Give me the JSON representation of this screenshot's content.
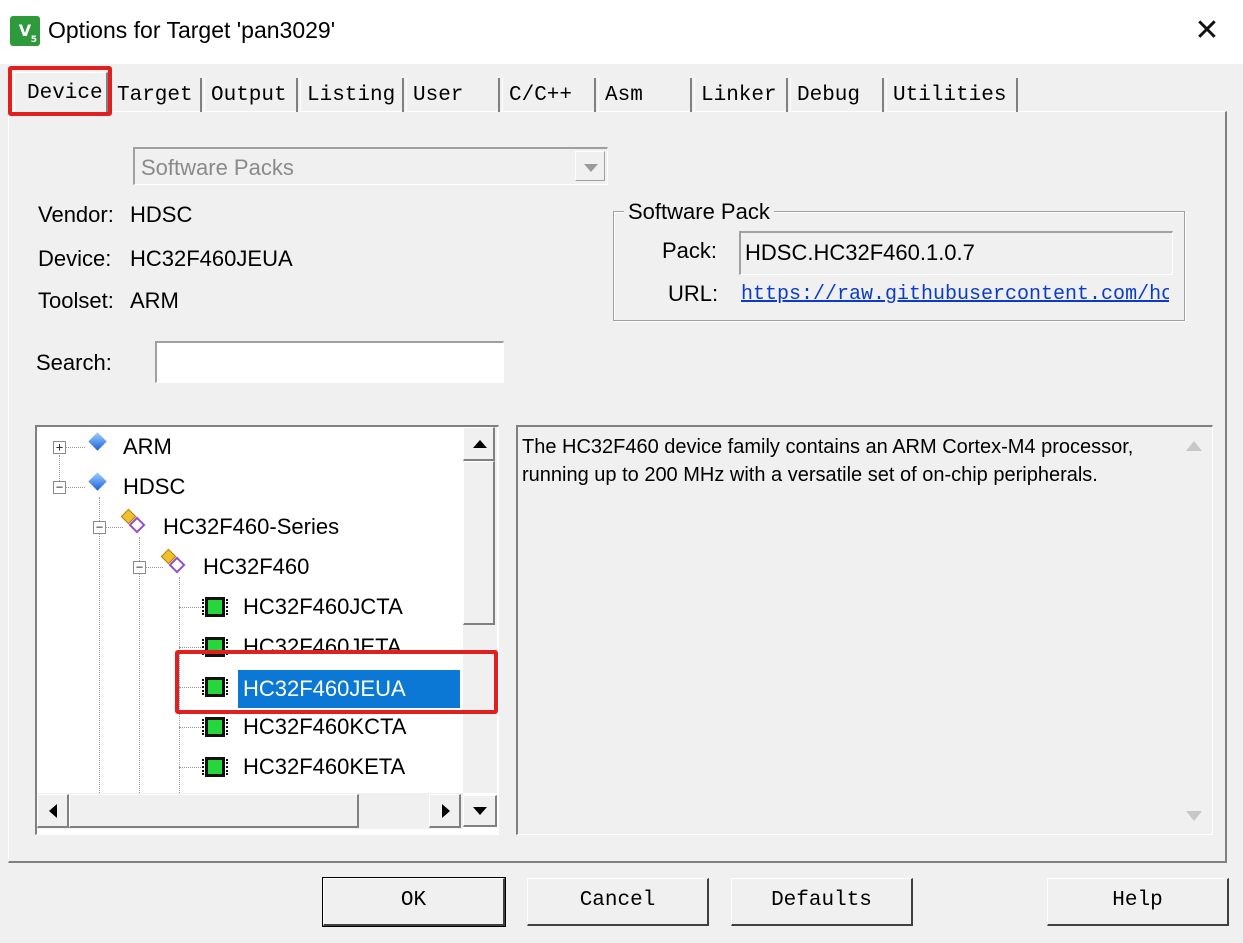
{
  "window": {
    "title": "Options for Target 'pan3029'",
    "icon_name": "keil-uvision-icon",
    "close_symbol": "✕"
  },
  "tabs": [
    {
      "label": "Device",
      "active": true
    },
    {
      "label": "Target"
    },
    {
      "label": "Output"
    },
    {
      "label": "Listing"
    },
    {
      "label": "User"
    },
    {
      "label": "C/C++"
    },
    {
      "label": "Asm"
    },
    {
      "label": "Linker"
    },
    {
      "label": "Debug"
    },
    {
      "label": "Utilities"
    }
  ],
  "device_panel": {
    "database_select": "Software Packs",
    "vendor_label": "Vendor:",
    "vendor_value": "HDSC",
    "device_label": "Device:",
    "device_value": "HC32F460JEUA",
    "toolset_label": "Toolset:",
    "toolset_value": "ARM",
    "search_label": "Search:",
    "search_value": ""
  },
  "software_pack": {
    "group_title": "Software Pack",
    "pack_label": "Pack:",
    "pack_value": "HDSC.HC32F460.1.0.7",
    "url_label": "URL:",
    "url_value": "https://raw.githubusercontent.com/hc"
  },
  "tree": {
    "items": [
      {
        "label": "ARM",
        "expander": "+",
        "icon": "vendor-gem-icon"
      },
      {
        "label": "HDSC",
        "expander": "−",
        "icon": "vendor-gem-icon"
      },
      {
        "label": "HC32F460-Series",
        "expander": "−",
        "icon": "device-family-icon"
      },
      {
        "label": "HC32F460",
        "expander": "−",
        "icon": "device-subfamily-icon"
      },
      {
        "label": "HC32F460JCTA",
        "icon": "chip-icon"
      },
      {
        "label": "HC32F460JETA",
        "icon": "chip-icon"
      },
      {
        "label": "HC32F460JEUA",
        "icon": "chip-icon",
        "selected": true
      },
      {
        "label": "HC32F460KCTA",
        "icon": "chip-icon"
      },
      {
        "label": "HC32F460KETA",
        "icon": "chip-icon"
      }
    ]
  },
  "description": {
    "text": "The HC32F460 device family contains an ARM Cortex-M4 processor, running up to 200 MHz with a versatile set of on-chip peripherals."
  },
  "buttons": {
    "ok": "OK",
    "cancel": "Cancel",
    "defaults": "Defaults",
    "help": "Help"
  },
  "colors": {
    "highlight_annotation": "#e02020",
    "selection": "#0a78d4",
    "link": "#0a3cc8"
  }
}
